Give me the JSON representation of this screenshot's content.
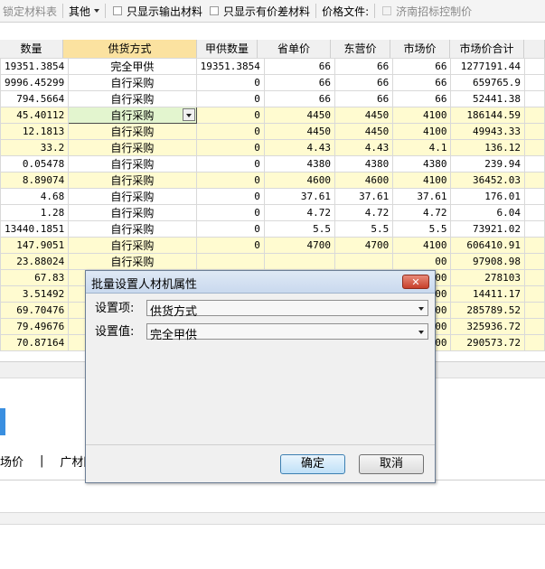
{
  "toolbar": {
    "item1": "锁定材料表",
    "item2": "其他",
    "item3": "只显示输出材料",
    "item4": "只显示有价差材料",
    "item5": "价格文件:",
    "item6": "济南招标控制价"
  },
  "table": {
    "headers": [
      "数量",
      "供货方式",
      "甲供数量",
      "省单价",
      "东营价",
      "市场价",
      "市场价合计"
    ],
    "rows": [
      {
        "qty": "19351.3854",
        "supply": "完全甲供",
        "jia": "19351.3854",
        "prov": "66",
        "dy": "66",
        "mkt": "66",
        "total": "1277191.44"
      },
      {
        "qty": "9996.45299",
        "supply": "自行采购",
        "jia": "0",
        "prov": "66",
        "dy": "66",
        "mkt": "66",
        "total": "659765.9"
      },
      {
        "qty": "794.5664",
        "supply": "自行采购",
        "jia": "0",
        "prov": "66",
        "dy": "66",
        "mkt": "66",
        "total": "52441.38"
      },
      {
        "qty": "45.40112",
        "supply": "自行采购",
        "jia": "0",
        "prov": "4450",
        "dy": "4450",
        "mkt": "4100",
        "total": "186144.59"
      },
      {
        "qty": "12.1813",
        "supply": "自行采购",
        "jia": "0",
        "prov": "4450",
        "dy": "4450",
        "mkt": "4100",
        "total": "49943.33"
      },
      {
        "qty": "33.2",
        "supply": "自行采购",
        "jia": "0",
        "prov": "4.43",
        "dy": "4.43",
        "mkt": "4.1",
        "total": "136.12"
      },
      {
        "qty": "0.05478",
        "supply": "自行采购",
        "jia": "0",
        "prov": "4380",
        "dy": "4380",
        "mkt": "4380",
        "total": "239.94"
      },
      {
        "qty": "8.89074",
        "supply": "自行采购",
        "jia": "0",
        "prov": "4600",
        "dy": "4600",
        "mkt": "4100",
        "total": "36452.03"
      },
      {
        "qty": "4.68",
        "supply": "自行采购",
        "jia": "0",
        "prov": "37.61",
        "dy": "37.61",
        "mkt": "37.61",
        "total": "176.01"
      },
      {
        "qty": "1.28",
        "supply": "自行采购",
        "jia": "0",
        "prov": "4.72",
        "dy": "4.72",
        "mkt": "4.72",
        "total": "6.04"
      },
      {
        "qty": "13440.1851",
        "supply": "自行采购",
        "jia": "0",
        "prov": "5.5",
        "dy": "5.5",
        "mkt": "5.5",
        "total": "73921.02"
      },
      {
        "qty": "147.9051",
        "supply": "自行采购",
        "jia": "0",
        "prov": "4700",
        "dy": "4700",
        "mkt": "4100",
        "total": "606410.91"
      },
      {
        "qty": "23.88024",
        "supply": "自行采购",
        "jia": "",
        "prov": "",
        "dy": "",
        "mkt": "00",
        "total": "97908.98"
      },
      {
        "qty": "67.83",
        "supply": "",
        "jia": "",
        "prov": "",
        "dy": "",
        "mkt": "00",
        "total": "278103"
      },
      {
        "qty": "3.51492",
        "supply": "",
        "jia": "",
        "prov": "",
        "dy": "",
        "mkt": "00",
        "total": "14411.17"
      },
      {
        "qty": "69.70476",
        "supply": "",
        "jia": "",
        "prov": "",
        "dy": "",
        "mkt": "00",
        "total": "285789.52"
      },
      {
        "qty": "79.49676",
        "supply": "",
        "jia": "",
        "prov": "",
        "dy": "",
        "mkt": "00",
        "total": "325936.72"
      },
      {
        "qty": "70.87164",
        "supply": "",
        "jia": "",
        "prov": "",
        "dy": "",
        "mkt": "00",
        "total": "290573.72"
      }
    ]
  },
  "bottom": {
    "link1": "场价",
    "sep": "|",
    "link2": "广材网"
  },
  "dialog": {
    "title": "批量设置人材机属性",
    "close": "✕",
    "label_item": "设置项:",
    "value_item": "供货方式",
    "label_value": "设置值:",
    "value_value": "完全甲供",
    "ok": "确定",
    "cancel": "取消"
  },
  "colors": {
    "row_yellow": "#fffbd0",
    "header_active": "#fbe2a0",
    "selected_cell": "#e3f5cf",
    "accent_blue": "#3a8fe0"
  }
}
